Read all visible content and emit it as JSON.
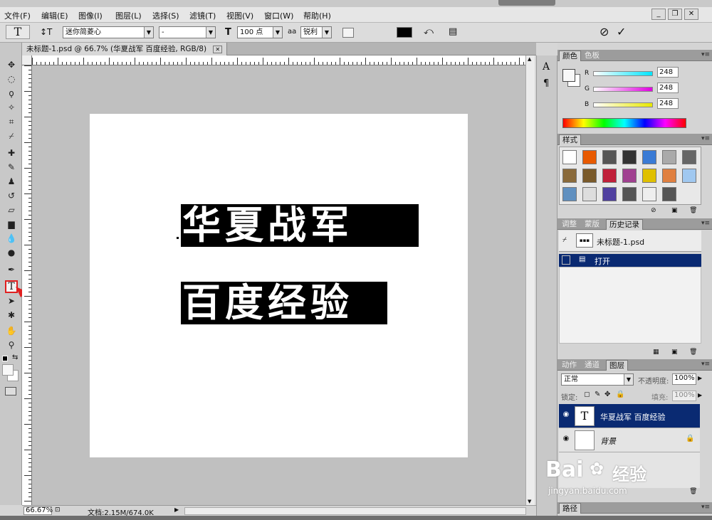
{
  "menubar": {
    "items": [
      "文件(F)",
      "编辑(E)",
      "图像(I)",
      "图层(L)",
      "选择(S)",
      "滤镜(T)",
      "视图(V)",
      "窗口(W)",
      "帮助(H)"
    ],
    "window_buttons": {
      "minimize": "_",
      "restore": "❐",
      "close": "✕"
    }
  },
  "options": {
    "tool_icon": "T",
    "font_family": "迷你简菱心",
    "font_style": "-",
    "font_size": "100 点",
    "aa_icon": "aa",
    "antialias": "锐利",
    "text_color": "#000000",
    "cancel_icon": "⊘",
    "commit_icon": "✓"
  },
  "document": {
    "tab_title": "未标题-1.psd @ 66.7% (华夏战军 百度经验, RGB/8)",
    "tab_close": "✕",
    "text_line1": "华夏战军",
    "text_line2": "百度经验"
  },
  "status": {
    "zoom": "66.67%",
    "doc_info": "文档:2.15M/674.0K"
  },
  "color_panel": {
    "tabs": [
      "颜色",
      "色板"
    ],
    "channels": [
      {
        "label": "R",
        "value": "248",
        "color": "#00e5ff"
      },
      {
        "label": "G",
        "value": "248",
        "color": "#e000e0"
      },
      {
        "label": "B",
        "value": "248",
        "color": "#e8e800"
      }
    ]
  },
  "styles_panel": {
    "tab": "样式",
    "swatch_colors": [
      "#ffffff",
      "#e85a00",
      "#555555",
      "#333333",
      "#3a7bd5",
      "#aaaaaa",
      "#666666",
      "#8a6a3a",
      "#7a5a2a",
      "#c0203a",
      "#a04090",
      "#e0c000",
      "#e08040",
      "#a0c8f0",
      "#6090c0",
      "#dddddd",
      "#5040a0",
      "#555555",
      "#eeeeee",
      "#555555"
    ]
  },
  "history_panel": {
    "tabs": [
      "调整",
      "蒙版",
      "历史记录"
    ],
    "snapshot": "未标题-1.psd",
    "items": [
      "打开"
    ]
  },
  "layers_panel": {
    "tabs": [
      "动作",
      "通道",
      "图层"
    ],
    "blend_mode": "正常",
    "opacity_label": "不透明度:",
    "opacity": "100%",
    "lock_label": "锁定:",
    "fill_label": "填充:",
    "fill": "100%",
    "layers": [
      {
        "name": "华夏战军 百度经验",
        "thumb": "T",
        "selected": true
      },
      {
        "name": "背景",
        "thumb": "",
        "selected": false
      }
    ]
  },
  "paths_tab": "路径",
  "mid_panel": {
    "char_icon": "A",
    "para_icon": "¶"
  },
  "watermark": {
    "brand": "Bai",
    "brand2": "经验",
    "url": "jingyan.baidu.com"
  }
}
